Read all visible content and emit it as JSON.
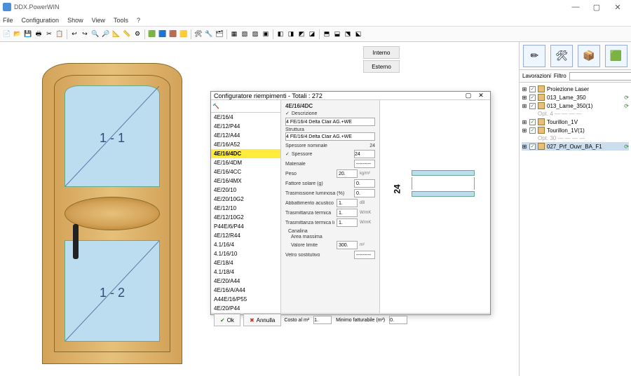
{
  "app": {
    "title": "DDX.PowerWIN"
  },
  "window_controls": {
    "min": "—",
    "max": "▢",
    "close": "✕"
  },
  "menu": [
    "File",
    "Configuration",
    "Show",
    "View",
    "Tools",
    "?"
  ],
  "view_tabs": {
    "inside": "Interno",
    "outside": "Esterno"
  },
  "door": {
    "pane1": "1 - 1",
    "pane2": "1 - 2"
  },
  "dialog": {
    "title": "Configuratore riempimenti - Totali : 272",
    "list": [
      "4E/16/4",
      "4E/12/P44",
      "4E/12/A44",
      "4E/16/A52",
      "4E/16/4DC",
      "4E/16/4DM",
      "4E/16/4CC",
      "4E/16/4MX",
      "4E/20/10",
      "4E/20/10G2",
      "4E/12/10",
      "4E/12/10G2",
      "P44E/6/P44",
      "4E/12/R44",
      "4.1/16/4",
      "4.1/16/10",
      "4E/18/4",
      "4.1/18/4",
      "4E/20/A44",
      "4E/16/A/A44",
      "A44E/16/P55",
      "4E/20/P44"
    ],
    "selected_index": 4,
    "form": {
      "heading": "4E/16/4DC",
      "descrizione_chk_label": "Descrizione",
      "descrizione": "4 FE/16/4 Delta Clair AG.+WE",
      "struttura_label": "Struttura",
      "struttura": "4 FE/16/4 Delta Clair AG.+WE",
      "spessore_nominale_label": "Spessore nominale",
      "spessore_nominale": "24",
      "spessore_chk_label": "Spessore",
      "spessore": "24",
      "materiale_label": "Materiale",
      "materiale": "---------",
      "peso_label": "Peso",
      "peso": "20.",
      "peso_unit": "kg/m²",
      "fattore_solare_label": "Fattore solare (g)",
      "fattore_solare": "0.",
      "trasm_lum_label": "Trasmissione luminosa (%)",
      "trasm_lum": "0.",
      "abbatt_label": "Abbattimento acustico",
      "abbatt": "1.",
      "abbatt_unit": "dB",
      "trasm_term_label": "Trasmittanza termica",
      "trasm_term": "1.",
      "trasm_term_unit": "W/mK",
      "trasm_term_lin_label": "Trasmittanza termica lineare",
      "trasm_term_lin": "1.",
      "trasm_term_lin_unit": "W/mK",
      "canalina_label": "Canalina",
      "area_massima_label": "Area massima",
      "valore_limite_label": "Valore limite",
      "valore_limite": "300.",
      "valore_limite_unit": "m²",
      "vetro_sost_label": "Vetro sostitutivo",
      "vetro_sost": "---------",
      "costo_label": "Costo al m²",
      "costo": "1.",
      "minimo_label": "Minimo fatturabile (m²)",
      "minimo": "0."
    },
    "preview": {
      "dim": "24"
    },
    "footer": {
      "ok": "Ok",
      "cancel": "Annulla"
    }
  },
  "rightpanel": {
    "header_lav": "Lavorazioni",
    "header_filtro": "Filtro",
    "tree": [
      {
        "label": "Proiezione Laser",
        "chk": true,
        "ind": 0
      },
      {
        "label": "013_Lame_350",
        "chk": true,
        "ind": 0,
        "trail": "⟳"
      },
      {
        "label": "013_Lame_350(1)",
        "chk": true,
        "ind": 0,
        "trail": "⟳"
      },
      {
        "label": "Opt. 4 — — — —",
        "gray": true,
        "ind": 1
      },
      {
        "label": "Tourillon_1V",
        "chk": true,
        "ind": 0
      },
      {
        "label": "Tourillon_1V(1)",
        "chk": true,
        "ind": 0
      },
      {
        "label": "Opt. 30 — — — —",
        "gray": true,
        "ind": 1
      },
      {
        "label": "027_Prf_Ouvr_BA_F1",
        "chk": true,
        "ind": 0,
        "sel": true,
        "trail": "⟳"
      }
    ]
  },
  "toolbar_icons": [
    "📄",
    "📂",
    "💾",
    "🖶",
    "✂",
    "📋",
    "|",
    "↩",
    "↪",
    "🔍",
    "🔎",
    "📐",
    "📏",
    "⚙",
    "|",
    "🟩",
    "🟦",
    "🟫",
    "🟨",
    "|",
    "🛠",
    "🔧",
    "🗂",
    "|",
    "▦",
    "▧",
    "▨",
    "▣",
    "|",
    "◧",
    "◨",
    "◩",
    "◪",
    "|",
    "⬒",
    "⬓",
    "⬔",
    "⬕"
  ]
}
